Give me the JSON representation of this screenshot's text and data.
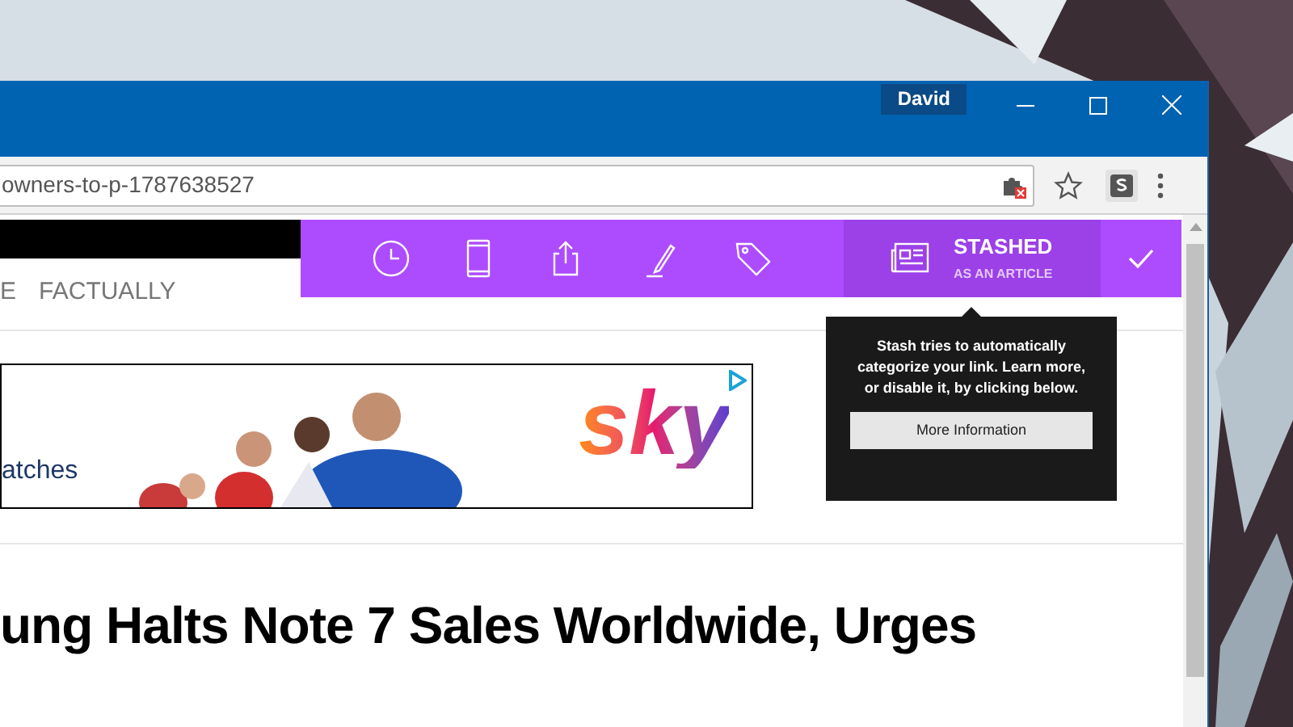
{
  "browser": {
    "profile": "David",
    "address": "owners-to-p-1787638527"
  },
  "stash_bar": {
    "status": {
      "title": "STASHED",
      "subtitle": "AS AN ARTICLE"
    }
  },
  "tooltip": {
    "text": "Stash tries to automatically categorize your link. Learn more, or disable it, by clicking below.",
    "button": "More Information"
  },
  "page": {
    "nav": [
      "E",
      "FACTUALLY"
    ],
    "ad": {
      "text": "atches",
      "logo": "sky"
    },
    "headline": "ung Halts Note 7 Sales Worldwide, Urges"
  }
}
